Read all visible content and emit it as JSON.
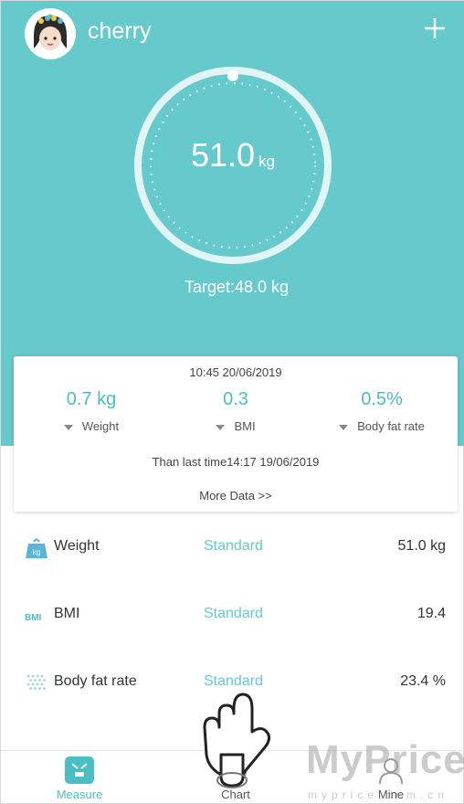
{
  "user": {
    "name": "cherry"
  },
  "header": {
    "add_icon": "plus-icon"
  },
  "gauge": {
    "value": "51.0",
    "unit": "kg",
    "target_text": "Target:48.0 kg"
  },
  "card": {
    "datetime": "10:45 20/06/2019",
    "metrics": [
      {
        "value": "0.7 kg",
        "label": "Weight"
      },
      {
        "value": "0.3",
        "label": "BMI"
      },
      {
        "value": "0.5%",
        "label": "Body fat rate"
      }
    ],
    "compare_text": "Than last time14:17 19/06/2019",
    "more_link": "More Data >>"
  },
  "rows": [
    {
      "icon": "weight-icon",
      "label": "Weight",
      "status": "Standard",
      "value": "51.0 kg"
    },
    {
      "icon": "bmi-icon",
      "icon_text": "BMI",
      "label": "BMI",
      "status": "Standard",
      "value": "19.4"
    },
    {
      "icon": "body-fat-icon",
      "label": "Body fat rate",
      "status": "Standard",
      "value": "23.4 %"
    }
  ],
  "tabs": [
    {
      "icon": "scale-icon",
      "label": "Measure",
      "active": true
    },
    {
      "icon": "chart-icon",
      "label": "Chart",
      "active": false
    },
    {
      "icon": "person-icon",
      "label": "Mine",
      "active": false
    }
  ],
  "watermark": {
    "main": "MyPrice",
    "sub": "myprice.com.cn"
  },
  "colors": {
    "accent": "#66c9cc",
    "accent_text": "#4bbec4",
    "text": "#333333"
  }
}
